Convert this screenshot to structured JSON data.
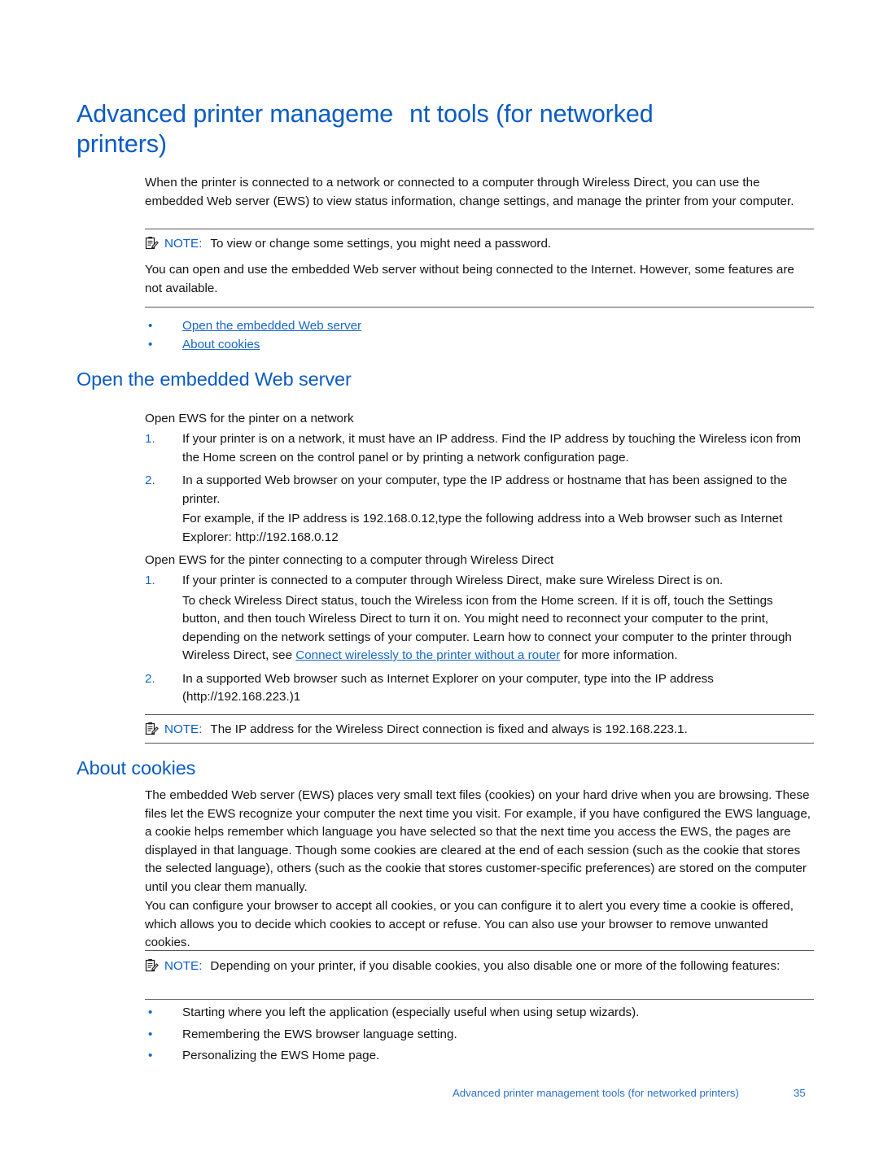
{
  "page": {
    "title_line1_a": "Advanced printer manageme",
    "title_line1_b": "nt tools (for networked",
    "title_line2": "printers)",
    "intro_paragraph": "When the printer is connected to a network or connected to a computer through Wireless Direct, you can use the embedded Web server (EWS) to view status information, change settings, and manage the printer from your computer."
  },
  "note1": {
    "icon": "note-clipboard-icon",
    "label": "NOTE:",
    "text": "To view or change some settings, you might need a password."
  },
  "note1_followup": "You can open and use the embedded Web server without being connected to the Internet. However, some features are not available.",
  "toc_links": [
    {
      "bullet": "•",
      "label": "Open the embedded Web server"
    },
    {
      "bullet": "•",
      "label": "About cookies"
    }
  ],
  "section_open": {
    "heading": "Open the embedded Web server",
    "sub1_label": "Open EWS for the pinter on a network",
    "sub1_items": [
      {
        "marker": "1.",
        "text": "If your printer is on a network, it must have an IP address. Find the IP address by touching the Wireless icon from the Home screen on the control panel or by printing a network configuration page."
      },
      {
        "marker": "2.",
        "text": "In a supported Web browser on your computer, type the IP address or hostname that has been assigned to the printer.",
        "extra": "For example, if the IP address is 192.168.0.12,type the following address into a Web browser such as Internet Explorer: http://192.168.0.12"
      }
    ],
    "sub2_label": "Open EWS for the pinter connecting to a computer through Wireless Direct",
    "sub2_items": [
      {
        "marker": "1.",
        "text_a": "If your printer is connected to a computer through Wireless Direct, make sure Wireless Direct is on.",
        "text_b": "To check Wireless Direct status, touch the Wireless  icon from the Home screen. If it is off, touch the Settings  button, and then touch Wireless Direct  to turn it on. You might need to reconnect your computer to the print, depending on the network settings of your computer. Learn how to connect your computer to the printer through Wireless Direct, see ",
        "link": "Connect wirelessly to the printer without a router",
        "text_c": " for more information."
      },
      {
        "marker": "2.",
        "text": "In a supported Web browser such as Internet Explorer on your computer, type into the IP address (http://192.168.223.)1"
      }
    ]
  },
  "note2": {
    "icon": "note-clipboard-icon",
    "label": "NOTE:",
    "text": "The IP address for the Wireless Direct connection is fixed and always is 192.168.223.1."
  },
  "section_cookies": {
    "heading": "About cookies",
    "para1": "The embedded Web server (EWS) places very small text files (cookies) on your hard drive when you are browsing. These files let the EWS recognize your computer the next time you visit. For example, if you have configured the EWS language, a cookie helps remember which language you have selected so that the next time you access the EWS, the pages are displayed in that language. Though some cookies are cleared at the end of each session (such as the cookie that stores the selected language), others (such as the cookie that stores customer-specific preferences) are stored on the computer until you clear them manually.",
    "para2": "You can configure your browser to accept all cookies, or you can configure it to alert you every time a cookie is offered, which allows you to decide which cookies to accept or refuse. You can also use your browser to remove unwanted cookies."
  },
  "note3": {
    "icon": "note-clipboard-icon",
    "label": "NOTE:",
    "text": "Depending on your printer, if you disable cookies, you also disable one or more of the following features:"
  },
  "feature_bullets": [
    {
      "bullet": "•",
      "label": "Starting where you left the application (especially useful when using setup wizards)."
    },
    {
      "bullet": "•",
      "label": "Remembering the EWS browser language setting."
    },
    {
      "bullet": "•",
      "label": "Personalizing the EWS Home page."
    }
  ],
  "footer": {
    "title": "Advanced printer management tools (for networked printers)",
    "page_number": "35"
  },
  "colors": {
    "heading_blue": "#0A5BC4",
    "link_blue": "#1767C8",
    "footer_blue": "#2C6FC9",
    "body_black": "#141414",
    "rule_gray": "#555555"
  }
}
